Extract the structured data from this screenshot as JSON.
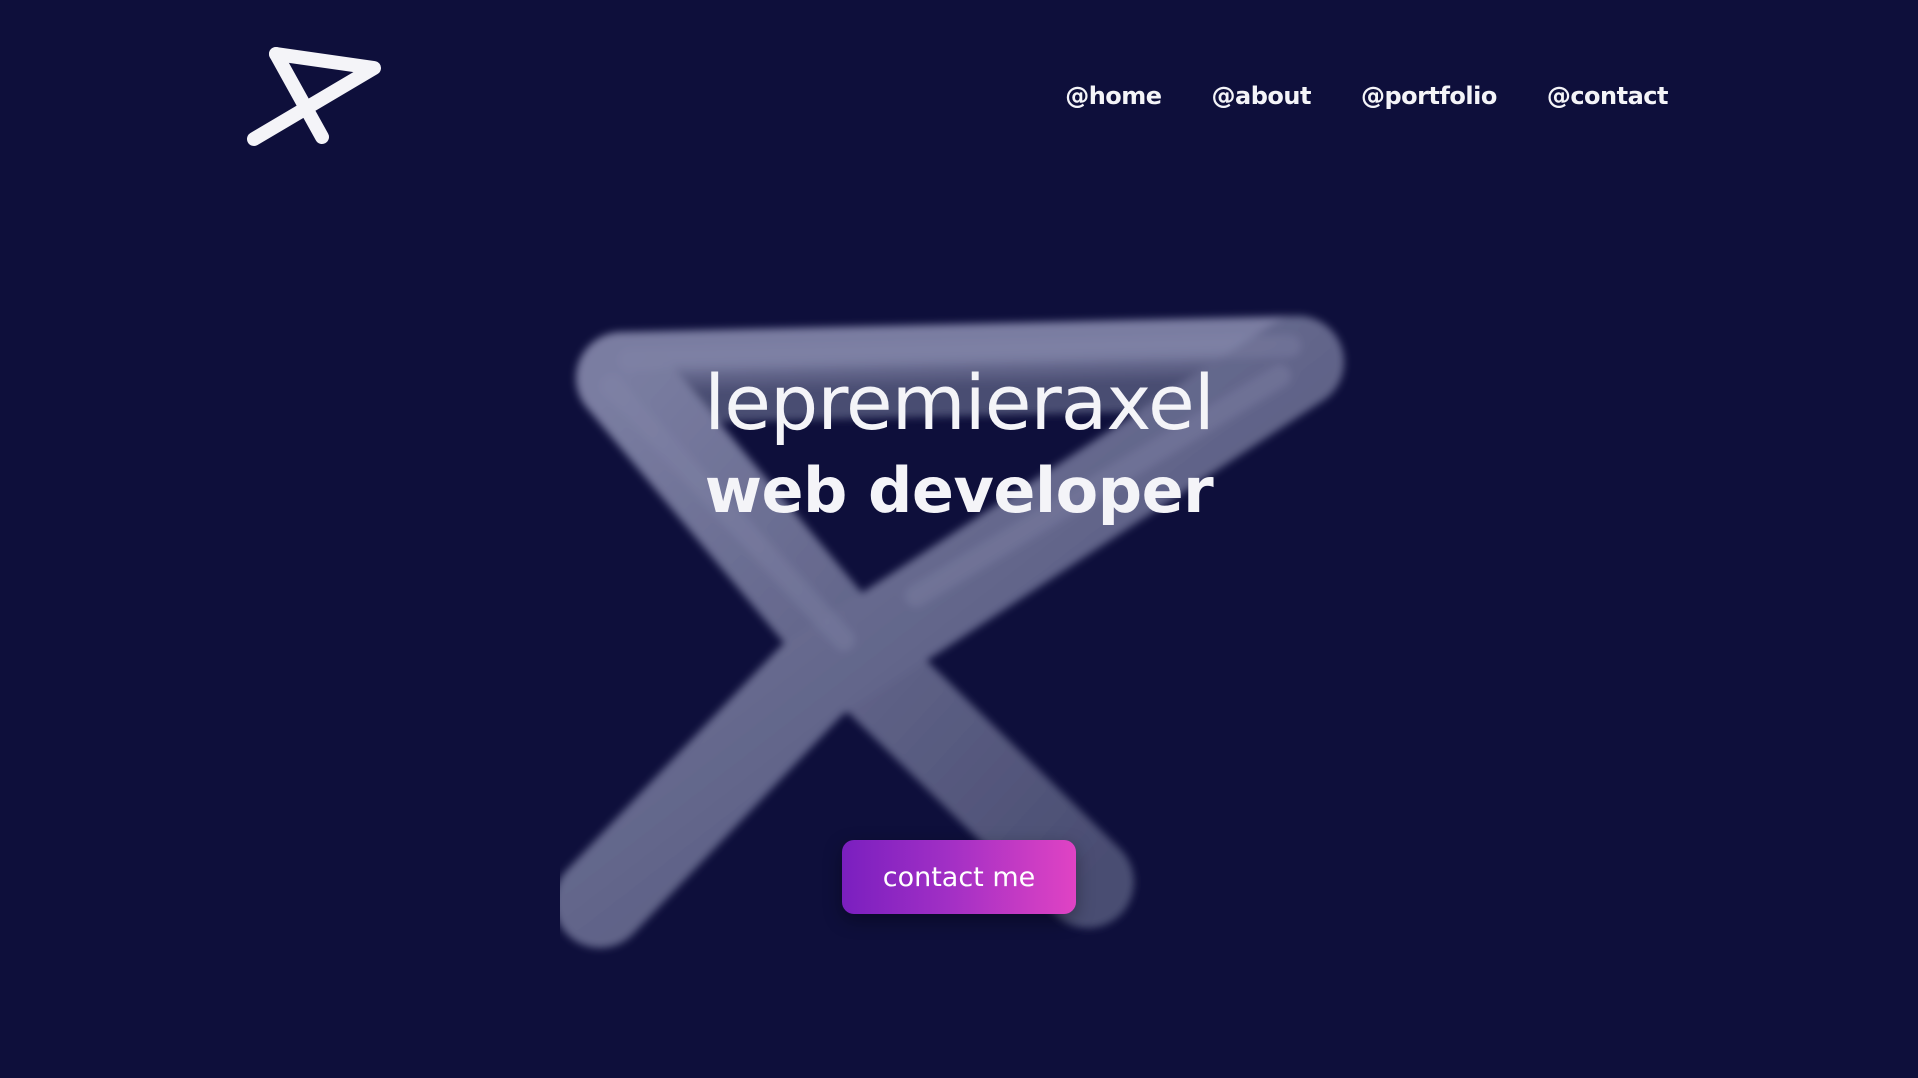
{
  "header": {
    "logo_icon": "stylized-a-logo-icon",
    "nav": [
      {
        "label": "@home"
      },
      {
        "label": "@about"
      },
      {
        "label": "@portfolio"
      },
      {
        "label": "@contact"
      }
    ]
  },
  "hero": {
    "title": "lepremieraxel",
    "subtitle": "web developer",
    "background_icon": "3d-x-shape-icon",
    "cta_label": "contact me"
  },
  "colors": {
    "background": "#0e0f3b",
    "text": "#f4f4f8",
    "shape": "#6a6d91",
    "cta_gradient_start": "#7a1fbf",
    "cta_gradient_end": "#e043c4"
  }
}
